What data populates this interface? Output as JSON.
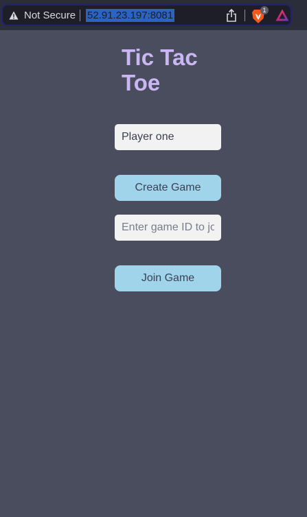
{
  "browser": {
    "security_label": "Not Secure",
    "url": "52.91.23.197:8081",
    "shield_badge_count": "1",
    "icons": {
      "security": "warning-triangle-icon",
      "share": "share-icon",
      "shields": "brave-shields-icon",
      "rewards": "brave-rewards-icon"
    }
  },
  "page": {
    "title_line1": "Tic Tac",
    "title_line2": "Toe",
    "player_name_value": "Player one",
    "create_game_label": "Create Game",
    "game_id_placeholder": "Enter game ID to join",
    "join_game_label": "Join Game"
  },
  "colors": {
    "page_background": "#4a4d5e",
    "title": "#c9b6f2",
    "button_background": "#9fd4ea",
    "input_background": "#f2f2f2",
    "url_highlight": "#2a63c4"
  }
}
